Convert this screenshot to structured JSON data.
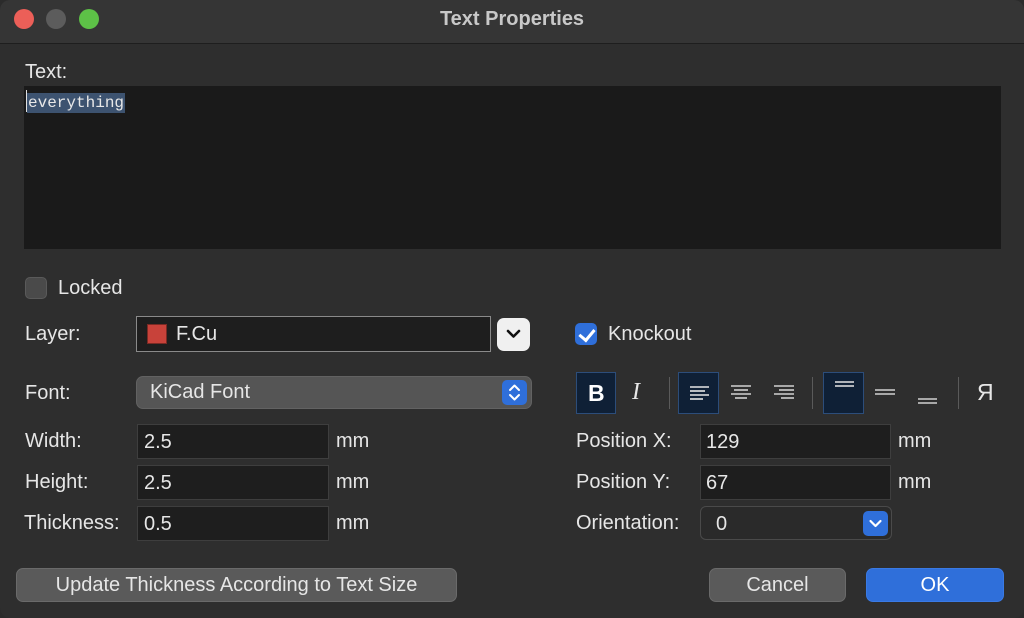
{
  "window": {
    "title": "Text Properties"
  },
  "text": {
    "label": "Text:",
    "value": "everything"
  },
  "locked": {
    "label": "Locked",
    "checked": false
  },
  "layer": {
    "label": "Layer:",
    "value": "F.Cu",
    "swatch_color": "#c8423a"
  },
  "knockout": {
    "label": "Knockout",
    "checked": true
  },
  "font": {
    "label": "Font:",
    "value": "KiCad Font"
  },
  "width": {
    "label": "Width:",
    "value": "2.5",
    "unit": "mm"
  },
  "height": {
    "label": "Height:",
    "value": "2.5",
    "unit": "mm"
  },
  "thickness": {
    "label": "Thickness:",
    "value": "0.5",
    "unit": "mm"
  },
  "position_x": {
    "label": "Position X:",
    "value": "129",
    "unit": "mm"
  },
  "position_y": {
    "label": "Position Y:",
    "value": "67",
    "unit": "mm"
  },
  "orientation": {
    "label": "Orientation:",
    "value": "0"
  },
  "format": {
    "bold_label": "B",
    "italic_label": "I",
    "mirror_label": "Я",
    "bold_active": true,
    "align_left_active": true,
    "valign_top_active": true
  },
  "buttons": {
    "update_thickness": "Update Thickness According to Text Size",
    "cancel": "Cancel",
    "ok": "OK"
  },
  "colors": {
    "accent": "#2f6fda",
    "selection": "#3d5370"
  }
}
